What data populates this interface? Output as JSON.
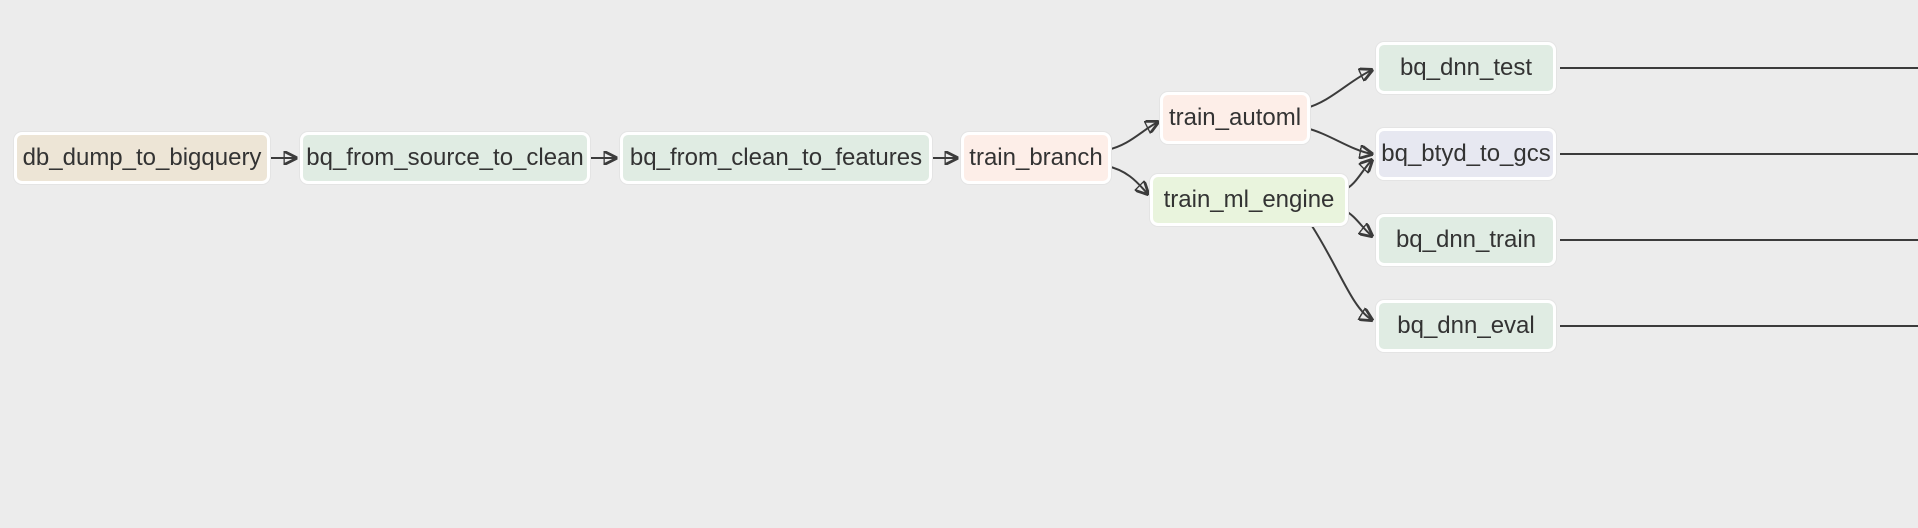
{
  "nodes": {
    "db_dump": {
      "label": "db_dump_to_bigquery"
    },
    "src_to_clean": {
      "label": "bq_from_source_to_clean"
    },
    "clean_to_feat": {
      "label": "bq_from_clean_to_features"
    },
    "train_branch": {
      "label": "train_branch"
    },
    "train_automl": {
      "label": "train_automl"
    },
    "train_ml_eng": {
      "label": "train_ml_engine"
    },
    "bq_dnn_test": {
      "label": "bq_dnn_test"
    },
    "bq_btyd_gcs": {
      "label": "bq_btyd_to_gcs"
    },
    "bq_dnn_train": {
      "label": "bq_dnn_train"
    },
    "bq_dnn_eval": {
      "label": "bq_dnn_eval"
    }
  }
}
